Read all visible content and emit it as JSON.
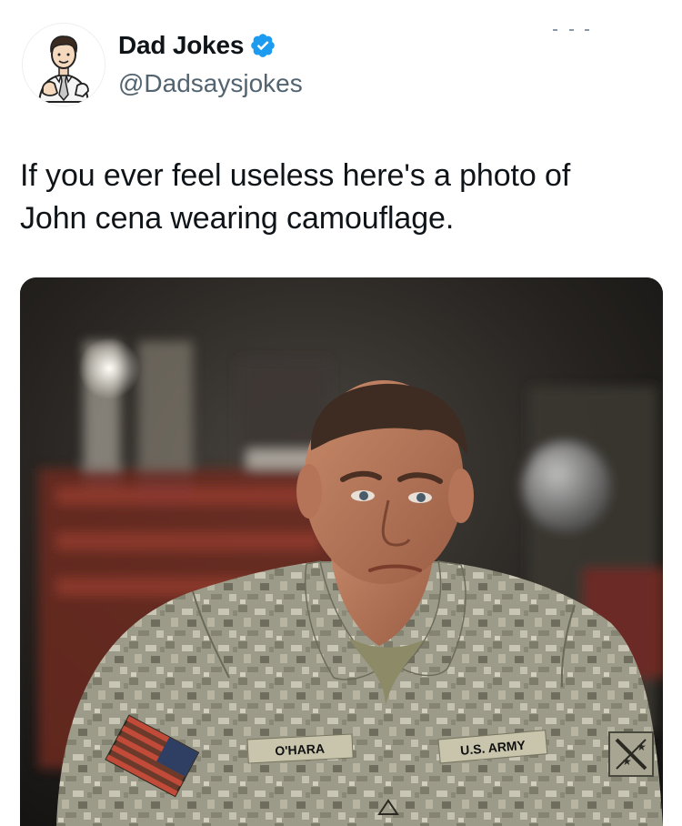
{
  "tweet": {
    "author": {
      "name": "Dad Jokes",
      "handle": "@Dadsaysjokes",
      "verified": true,
      "avatar_icon": "cartoon-dad-avatar-icon",
      "verified_color": "#1d9bf0"
    },
    "text_lines": [
      "If you ever feel useless here's a photo of",
      "John cena wearing camouflage."
    ],
    "media": {
      "kind": "photo",
      "name_tape": "O'HARA",
      "branch_tape": "U.S. ARMY"
    }
  }
}
